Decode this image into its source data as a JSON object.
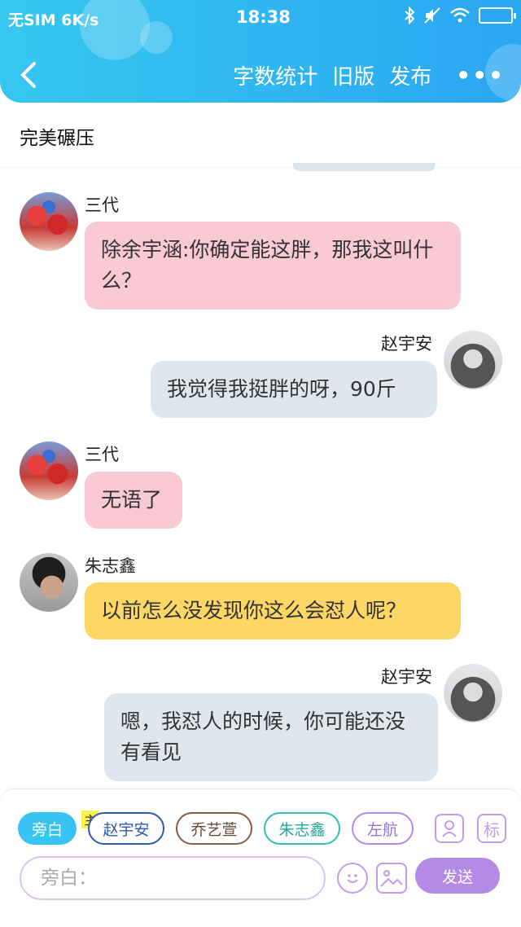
{
  "status_bar": {
    "carrier": "无SIM 6K/s",
    "time": "18:38"
  },
  "nav": {
    "back_icon": "chevron-left-icon",
    "word_count": "字数统计",
    "old_version": "旧版",
    "publish": "发布",
    "more": "•••"
  },
  "story_title": "完美碾压",
  "messages": [
    {
      "sender": "三代",
      "text": "除余宇涵:你确定能这胖，那我这叫什么？",
      "side": "left",
      "color": "#f9c9d5"
    },
    {
      "sender": "赵宇安",
      "text": "我觉得我挺胖的呀，90斤",
      "side": "right",
      "color": "#dfe6ed"
    },
    {
      "sender": "三代",
      "text": "无语了",
      "side": "left",
      "color": "#f9c9d5"
    },
    {
      "sender": "朱志鑫",
      "text": "以前怎么没发现你这么会怼人呢？",
      "side": "left",
      "color": "#fcd766"
    },
    {
      "sender": "赵宇安",
      "text": "嗯，我怼人的时候，你可能还没有看见",
      "side": "right",
      "color": "#dfe6ed"
    }
  ],
  "composer": {
    "narration": "旁白",
    "main_tag": "主",
    "characters": [
      {
        "name": "赵宇安",
        "color": "#2f58b8"
      },
      {
        "name": "乔艺萱",
        "color": "#8a5a44"
      },
      {
        "name": "朱志鑫",
        "color": "#2fbfb0"
      },
      {
        "name": "左航",
        "color": "#b38ae6"
      }
    ],
    "tool_label": "标",
    "placeholder": "旁白：",
    "send": "发送"
  },
  "colors": {
    "header": "#2fb6f0",
    "accent": "#b38ae6"
  }
}
